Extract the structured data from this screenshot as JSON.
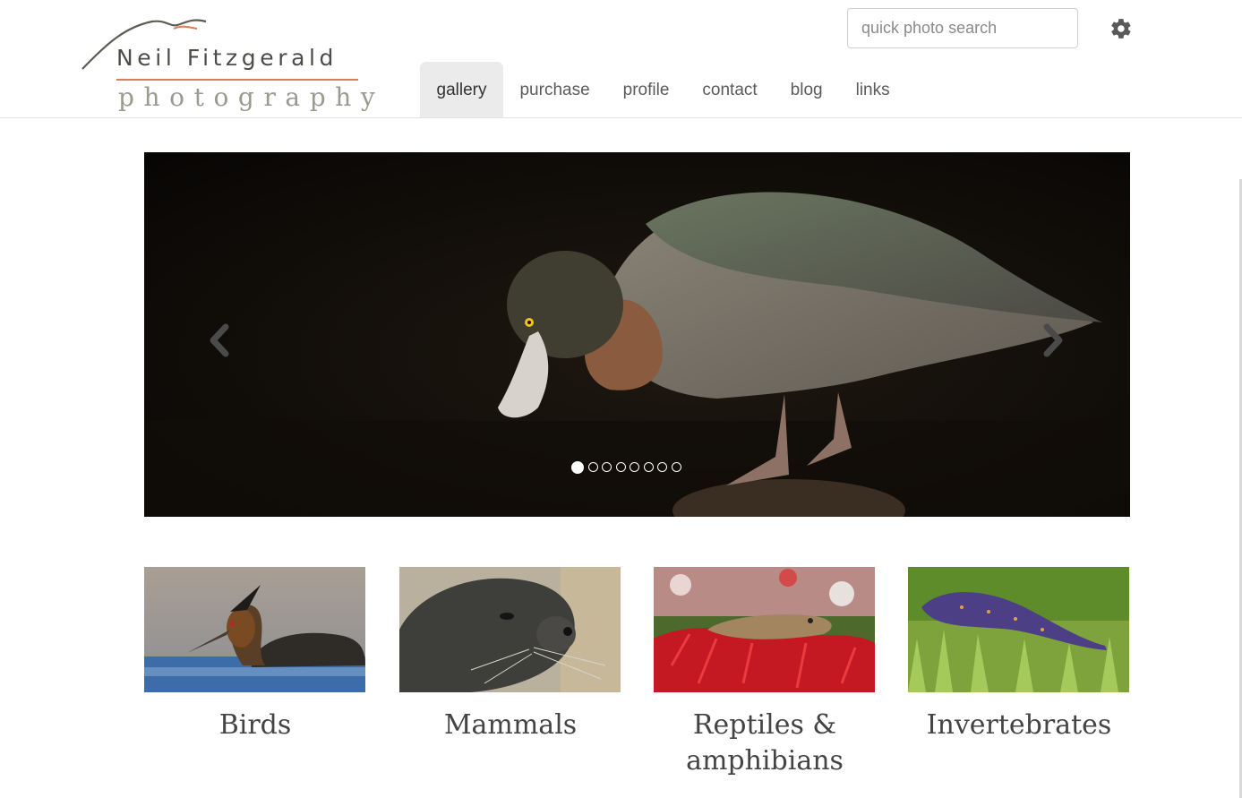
{
  "header": {
    "logo": {
      "name": "Neil Fitzgerald",
      "tagline": "photography",
      "accent_color": "#e07a5a"
    },
    "search": {
      "placeholder": "quick photo search",
      "value": ""
    },
    "settings_icon": "gear-icon",
    "nav": [
      {
        "label": "gallery",
        "active": true
      },
      {
        "label": "purchase",
        "active": false
      },
      {
        "label": "profile",
        "active": false
      },
      {
        "label": "contact",
        "active": false
      },
      {
        "label": "blog",
        "active": false
      },
      {
        "label": "links",
        "active": false
      }
    ]
  },
  "carousel": {
    "slide_count": 8,
    "active_slide": 1,
    "prev_icon": "chevron-left-icon",
    "next_icon": "chevron-right-icon"
  },
  "categories": [
    {
      "label": "Birds"
    },
    {
      "label": "Mammals"
    },
    {
      "label": "Reptiles & amphibians"
    },
    {
      "label": "Invertebrates"
    }
  ]
}
